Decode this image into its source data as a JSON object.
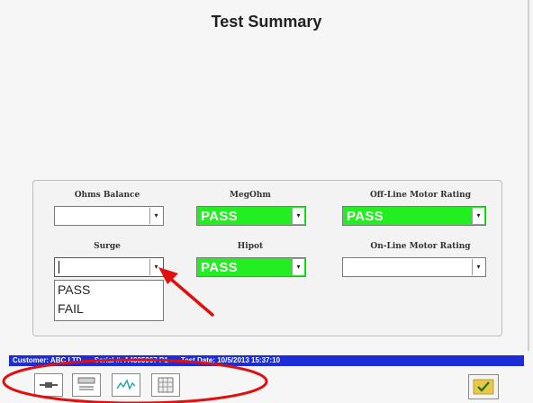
{
  "title": "Test Summary",
  "fields": {
    "ohms_balance": {
      "label": "Ohms Balance",
      "value": ""
    },
    "megohm": {
      "label": "MegOhm",
      "value": "PASS"
    },
    "offline_rating": {
      "label": "Off-Line Motor Rating",
      "value": "PASS"
    },
    "surge": {
      "label": "Surge",
      "value": "",
      "options": [
        "PASS",
        "FAIL"
      ]
    },
    "hipot": {
      "label": "Hipot",
      "value": "PASS"
    },
    "online_rating": {
      "label": "On-Line Motor Rating",
      "value": ""
    }
  },
  "status_bar": {
    "customer": "Customer: ABC LTD",
    "serial": "Serial #: A4385967 P1",
    "test_date": "Test Date: 10/5/2013 15:37:10"
  },
  "colors": {
    "pass": "#22ee22",
    "status_bar": "#1c2dd8",
    "annotation": "#e01010"
  },
  "icons": [
    "motor-icon",
    "data-icon",
    "waveform-icon",
    "grid-icon",
    "checkmark-icon"
  ]
}
